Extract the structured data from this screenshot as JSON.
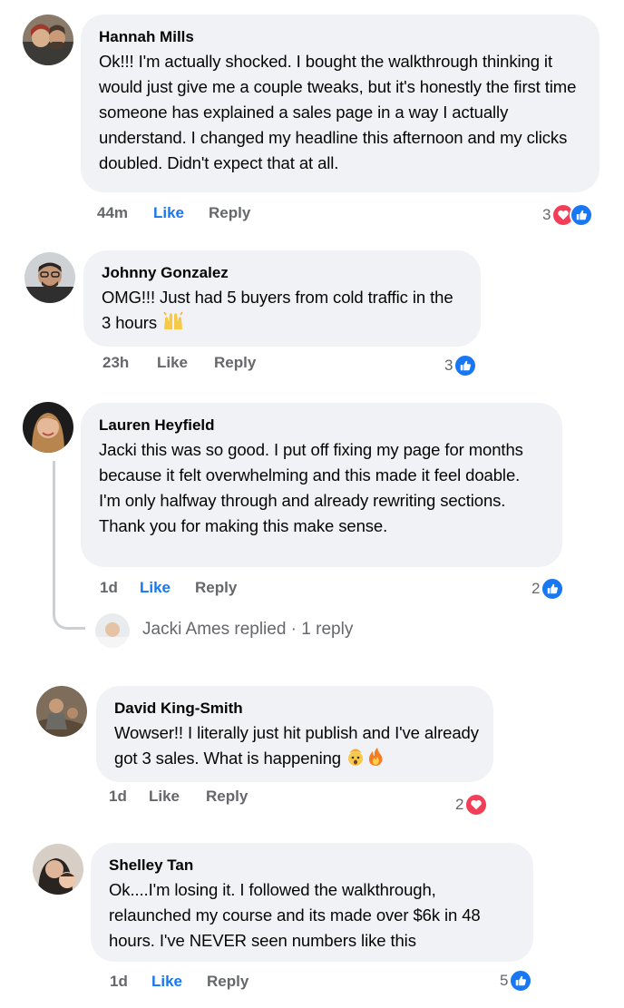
{
  "colors": {
    "like": "#1877f2",
    "love": "#f33e58",
    "bubble": "#f0f2f5",
    "meta": "#65676b"
  },
  "comments": [
    {
      "author": "Hannah Mills",
      "text": "Ok!!! I'm actually shocked. I bought the walkthrough thinking it would just give me a couple tweaks, but it's honestly the first time someone has explained a sales page in a way I actually understand. I changed my headline this afternoon and my clicks doubled. Didn't expect that at all.",
      "time": "44m",
      "like_label": "Like",
      "reply_label": "Reply",
      "reaction_count": "3",
      "reactions": [
        "love-icon",
        "like-icon"
      ],
      "liked": true
    },
    {
      "author": "Johnny Gonzalez",
      "text": "OMG!!! Just had 5 buyers from cold traffic in the 3 hours",
      "emoji": "raising-hands",
      "time": "23h",
      "like_label": "Like",
      "reply_label": "Reply",
      "reaction_count": "3",
      "reactions": [
        "like-icon"
      ],
      "liked": false
    },
    {
      "author": "Lauren Heyfield",
      "text": "Jacki this was so good. I put off fixing my page for months because it felt overwhelming and this made it feel doable. I'm only halfway through and already rewriting sections. Thank you for making this make sense.",
      "time": "1d",
      "like_label": "Like",
      "reply_label": "Reply",
      "reaction_count": "2",
      "reactions": [
        "like-icon"
      ],
      "liked": true,
      "replies_summary": "Jacki Ames replied · 1 reply"
    },
    {
      "author": "David King-Smith",
      "text": "Wowser!! I literally just hit publish and I've already got 3 sales. What is happening",
      "emoji": "exploding-head, fire",
      "time": "1d",
      "like_label": "Like",
      "reply_label": "Reply",
      "reaction_count": "2",
      "reactions": [
        "love-icon"
      ],
      "liked": false
    },
    {
      "author": "Shelley Tan",
      "text": "Ok....I'm losing it. I followed the walkthrough, relaunched my course and its made over $6k in 48 hours. I've NEVER seen numbers like this",
      "time": "1d",
      "like_label": "Like",
      "reply_label": "Reply",
      "reaction_count": "5",
      "reactions": [
        "like-icon"
      ],
      "liked": true
    }
  ]
}
